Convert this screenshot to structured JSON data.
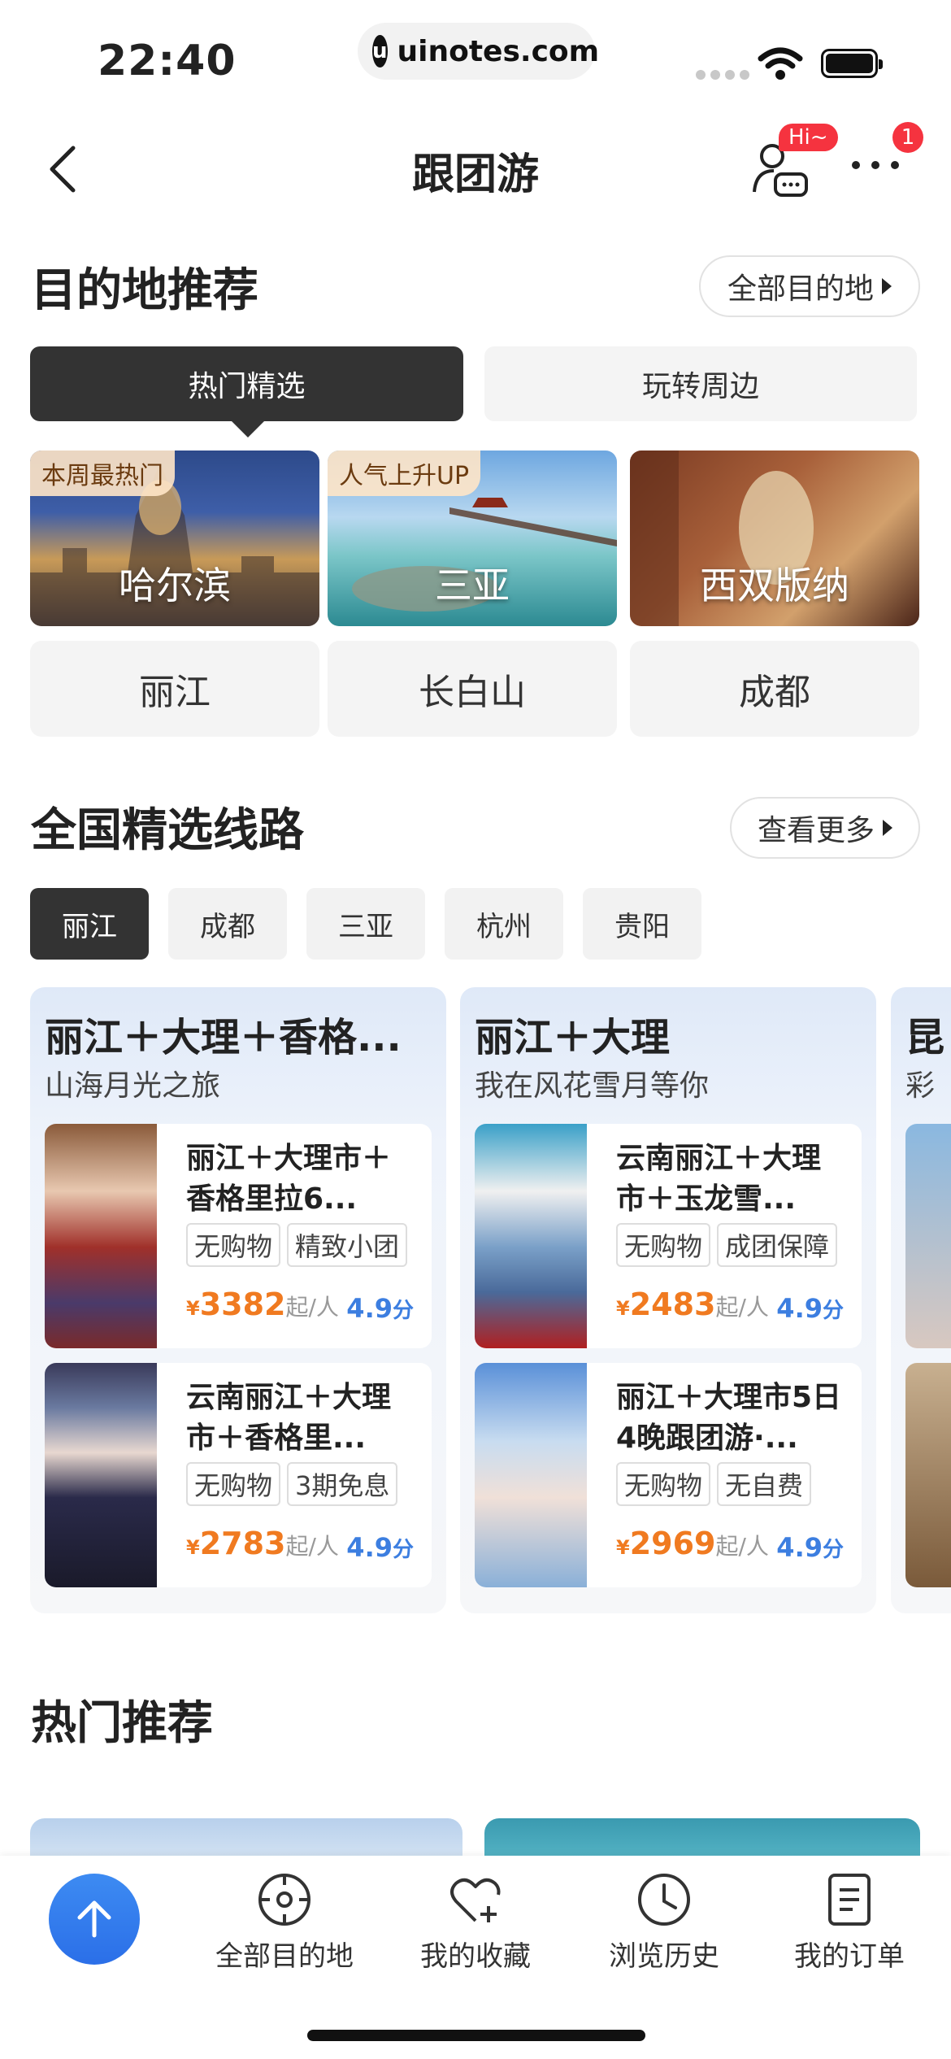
{
  "status_bar": {
    "time": "22:40",
    "url": "uinotes.com",
    "logo_letter": "u"
  },
  "nav": {
    "title": "跟团游",
    "hi_badge": "Hi~",
    "more_badge": "1"
  },
  "destinations": {
    "title": "目的地推荐",
    "all_button": "全部目的地",
    "tabs": [
      {
        "label": "热门精选",
        "active": true
      },
      {
        "label": "玩转周边",
        "active": false
      }
    ],
    "featured": [
      {
        "name": "哈尔滨",
        "tag": "本周最热门"
      },
      {
        "name": "三亚",
        "tag": "人气上升UP"
      },
      {
        "name": "西双版纳",
        "tag": ""
      }
    ],
    "others": [
      "丽江",
      "长白山",
      "成都"
    ]
  },
  "routes": {
    "title": "全国精选线路",
    "more_button": "查看更多",
    "cities": [
      {
        "label": "丽江",
        "active": true
      },
      {
        "label": "成都",
        "active": false
      },
      {
        "label": "三亚",
        "active": false
      },
      {
        "label": "杭州",
        "active": false
      },
      {
        "label": "贵阳",
        "active": false
      }
    ],
    "cards": [
      {
        "title": "丽江＋大理＋香格...",
        "subtitle": "山海月光之旅",
        "products": [
          {
            "title": "丽江＋大理市＋香格里拉6...",
            "tags": [
              "无购物",
              "精致小团"
            ],
            "currency": "¥",
            "price": "3382",
            "price_unit": "起/人",
            "score": "4.9",
            "score_unit": "分"
          },
          {
            "title": "云南丽江＋大理市＋香格里...",
            "tags": [
              "无购物",
              "3期免息"
            ],
            "currency": "¥",
            "price": "2783",
            "price_unit": "起/人",
            "score": "4.9",
            "score_unit": "分"
          }
        ]
      },
      {
        "title": "丽江＋大理",
        "subtitle": "我在风花雪月等你",
        "products": [
          {
            "title": "云南丽江＋大理市＋玉龙雪...",
            "tags": [
              "无购物",
              "成团保障"
            ],
            "currency": "¥",
            "price": "2483",
            "price_unit": "起/人",
            "score": "4.9",
            "score_unit": "分"
          },
          {
            "title": "丽江＋大理市5日4晚跟团游·...",
            "tags": [
              "无购物",
              "无自费"
            ],
            "currency": "¥",
            "price": "2969",
            "price_unit": "起/人",
            "score": "4.9",
            "score_unit": "分"
          }
        ]
      }
    ],
    "peek_card": {
      "title": "昆",
      "subtitle": "彩"
    }
  },
  "hot": {
    "title": "热门推荐"
  },
  "bottom_nav": [
    {
      "label": "全部目的地",
      "icon": "compass-icon"
    },
    {
      "label": "我的收藏",
      "icon": "heart-plus-icon"
    },
    {
      "label": "浏览历史",
      "icon": "clock-icon"
    },
    {
      "label": "我的订单",
      "icon": "order-list-icon"
    }
  ],
  "colors": {
    "accent_orange": "#f07a20",
    "score_blue": "#3c7ee0",
    "fab_blue": "#2b6fe8",
    "badge_red": "#f5333f",
    "dark": "#333333"
  }
}
